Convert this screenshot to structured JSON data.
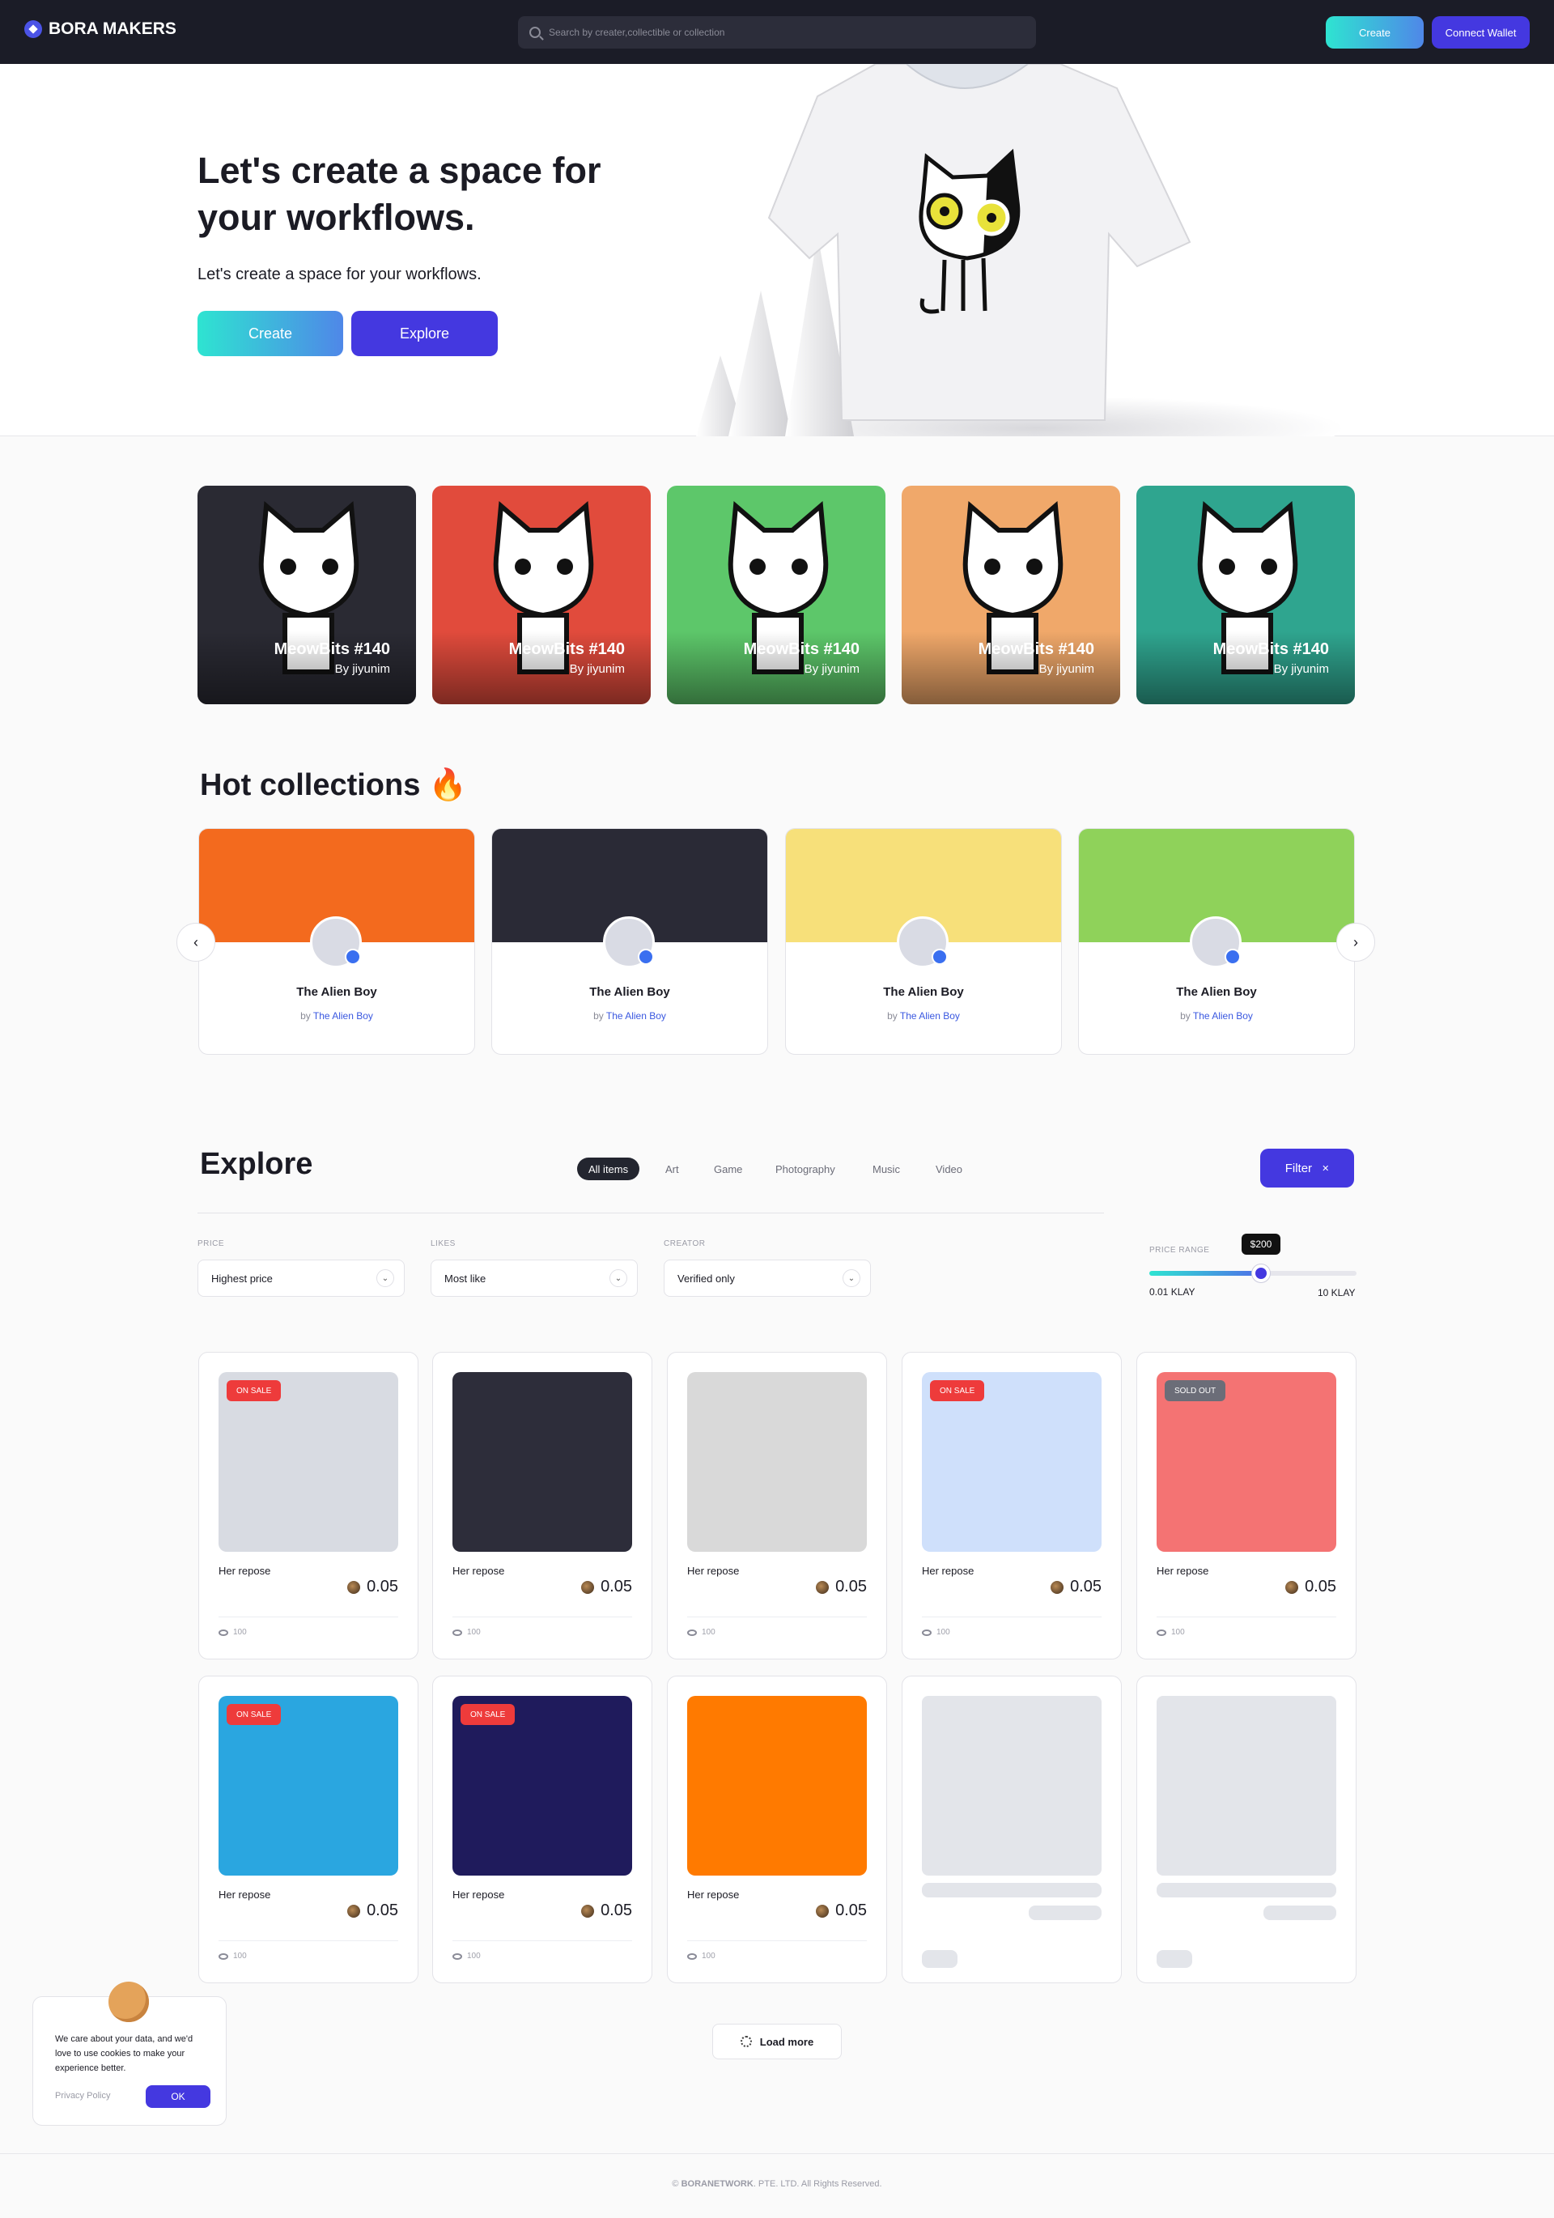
{
  "nav": {
    "brand": "BORA MAKERS",
    "search_placeholder": "Search by creater,collectible or collection",
    "create_label": "Create",
    "wallet_label": "Connect Wallet"
  },
  "hero": {
    "title": "Let's create a space for your workflows.",
    "subtitle": "Let's create a space for your workflows.",
    "create_label": "Create",
    "explore_label": "Explore"
  },
  "featured": [
    {
      "title": "MeowBits #140",
      "author": "By jiyunim",
      "bg": "#2a2a33"
    },
    {
      "title": "MeowBits #140",
      "author": "By jiyunim",
      "bg": "#e14b3c"
    },
    {
      "title": "MeowBits #140",
      "author": "By jiyunim",
      "bg": "#5dc76a"
    },
    {
      "title": "MeowBits #140",
      "author": "By jiyunim",
      "bg": "#f0a86a"
    },
    {
      "title": "MeowBits #140",
      "author": "By jiyunim",
      "bg": "#2fa58f"
    }
  ],
  "hot": {
    "title": "Hot collections 🔥",
    "prev_icon": "‹",
    "next_icon": "›",
    "items": [
      {
        "name": "The Alien Boy",
        "by": "by",
        "creator": "The Alien Boy",
        "banner": "#f36a1e"
      },
      {
        "name": "The Alien Boy",
        "by": "by",
        "creator": "The Alien Boy",
        "banner": "#2a2a36"
      },
      {
        "name": "The Alien Boy",
        "by": "by",
        "creator": "The Alien Boy",
        "banner": "#f7e07a"
      },
      {
        "name": "The Alien Boy",
        "by": "by",
        "creator": "The Alien Boy",
        "banner": "#8fd25a"
      }
    ]
  },
  "explore": {
    "title": "Explore",
    "tabs": [
      "All items",
      "Art",
      "Game",
      "Photography",
      "Music",
      "Video"
    ],
    "filter_label": "Filter",
    "filter_close": "✕",
    "filters": {
      "price_label": "PRICE",
      "price_value": "Highest price",
      "likes_label": "LIKES",
      "likes_value": "Most like",
      "creator_label": "CREATOR",
      "creator_value": "Verified only",
      "chevron": "⌄"
    },
    "price_range": {
      "label": "PRICE RANGE",
      "tooltip": "$200",
      "min": "0.01 KLAY",
      "max": "10 KLAY",
      "level": 0.54
    },
    "items": [
      {
        "title": "Her repose",
        "price": "0.05",
        "views": "100",
        "badge": "ON SALE",
        "badge_color": "#ee3b3b",
        "bg": "#d8dbe2"
      },
      {
        "title": "Her repose",
        "price": "0.05",
        "views": "100",
        "badge": "",
        "badge_color": "",
        "bg": "#2d2d3a"
      },
      {
        "title": "Her repose",
        "price": "0.05",
        "views": "100",
        "badge": "",
        "badge_color": "",
        "bg": "#d9d9d9"
      },
      {
        "title": "Her repose",
        "price": "0.05",
        "views": "100",
        "badge": "ON SALE",
        "badge_color": "#ee3b3b",
        "bg": "#cfe0fb"
      },
      {
        "title": "Her repose",
        "price": "0.05",
        "views": "100",
        "badge": "SOLD OUT",
        "badge_color": "#6b6d78",
        "bg": "#f47373"
      },
      {
        "title": "Her repose",
        "price": "0.05",
        "views": "100",
        "badge": "ON SALE",
        "badge_color": "#ee3b3b",
        "bg": "#2aa6e0"
      },
      {
        "title": "Her repose",
        "price": "0.05",
        "views": "100",
        "badge": "ON SALE",
        "badge_color": "#ee3b3b",
        "bg": "#1f1b5c"
      },
      {
        "title": "Her repose",
        "price": "0.05",
        "views": "100",
        "badge": "",
        "badge_color": "",
        "bg": "#ff7a00"
      }
    ],
    "load_more": "Load more"
  },
  "cookie": {
    "text": "We care about your data, and we'd love to use cookies to make your experience better.",
    "policy": "Privacy Policy",
    "ok": "OK"
  },
  "footer": {
    "brand": "BORANETWORK",
    "text": ". PTE. LTD. All Rights Reserved.",
    "copy": "©"
  }
}
